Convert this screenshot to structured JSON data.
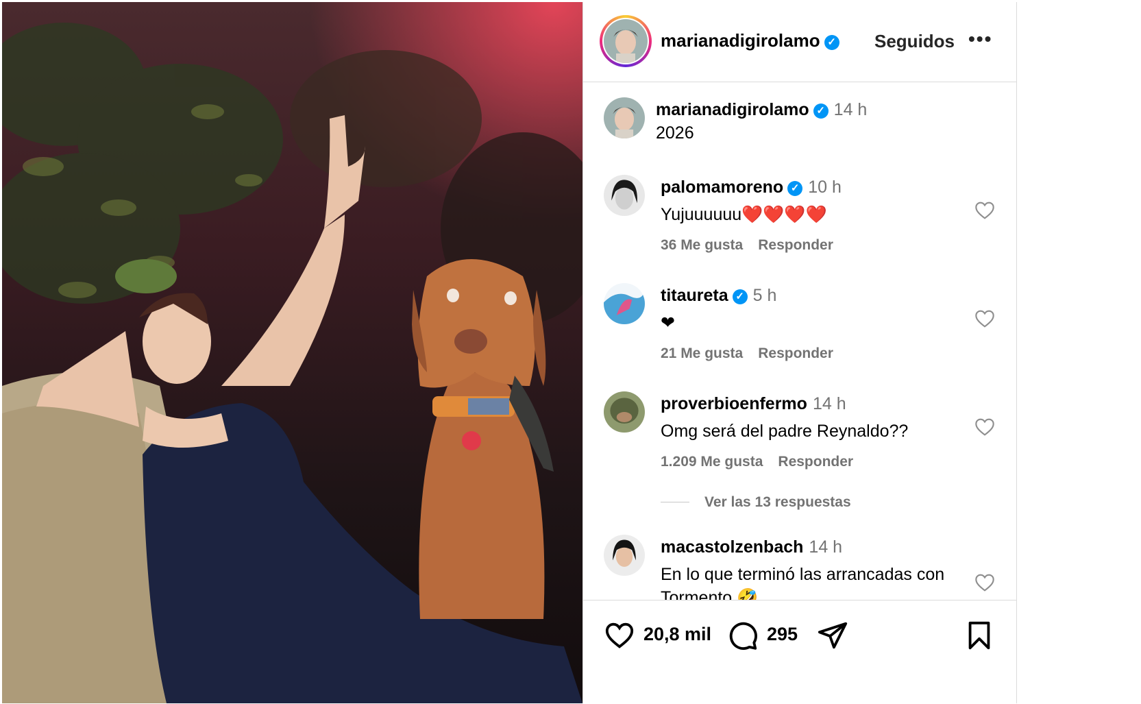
{
  "post": {
    "image_description_icon": "photo-woman-with-dog"
  },
  "header": {
    "username": "marianadigirolamo",
    "follow_label": "Seguidos",
    "more_icon": "•••"
  },
  "caption": {
    "username": "marianadigirolamo",
    "time": "14 h",
    "text": "2026"
  },
  "comments": [
    {
      "username": "palomamoreno",
      "verified": true,
      "time": "10 h",
      "text": "Yujuuuuuu❤️❤️❤️❤️",
      "likes": "36 Me gusta",
      "reply": "Responder"
    },
    {
      "username": "titaureta",
      "verified": true,
      "time": "5 h",
      "text": "❤",
      "likes": "21 Me gusta",
      "reply": "Responder"
    },
    {
      "username": "proverbioenfermo",
      "verified": false,
      "time": "14 h",
      "text": "Omg será del padre Reynaldo??",
      "likes": "1.209 Me gusta",
      "reply": "Responder"
    },
    {
      "username": "macastolzenbach",
      "verified": false,
      "time": "14 h",
      "text": "En lo que terminó las arrancadas con Tormento 🤣"
    }
  ],
  "replies_link": "Ver las 13 respuestas",
  "actions": {
    "likes_count": "20,8 mil",
    "comments_count": "295"
  },
  "colors": {
    "verified": "#0095f6",
    "meta": "#737373",
    "border": "#dbdbdb"
  }
}
